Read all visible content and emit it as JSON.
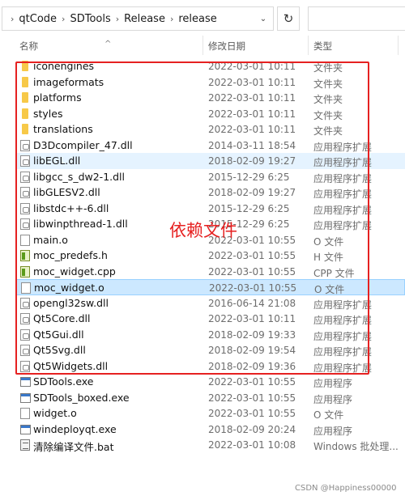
{
  "address": {
    "crumbs": [
      "qtCode",
      "SDTools",
      "Release",
      "release"
    ],
    "separator": "›",
    "dropdown_glyph": "⌄",
    "refresh_glyph": "↻"
  },
  "columns": {
    "name": "名称",
    "date": "修改日期",
    "type": "类型",
    "sort_glyph": "^"
  },
  "files": [
    {
      "name": "iconengines",
      "date": "2022-03-01 10:11",
      "type": "文件夹",
      "icon": "folder-icon"
    },
    {
      "name": "imageformats",
      "date": "2022-03-01 10:11",
      "type": "文件夹",
      "icon": "folder-icon"
    },
    {
      "name": "platforms",
      "date": "2022-03-01 10:11",
      "type": "文件夹",
      "icon": "folder-icon"
    },
    {
      "name": "styles",
      "date": "2022-03-01 10:11",
      "type": "文件夹",
      "icon": "folder-icon"
    },
    {
      "name": "translations",
      "date": "2022-03-01 10:11",
      "type": "文件夹",
      "icon": "folder-icon"
    },
    {
      "name": "D3Dcompiler_47.dll",
      "date": "2014-03-11 18:54",
      "type": "应用程序扩展",
      "icon": "dll-icon"
    },
    {
      "name": "libEGL.dll",
      "date": "2018-02-09 19:27",
      "type": "应用程序扩展",
      "icon": "dll-icon"
    },
    {
      "name": "libgcc_s_dw2-1.dll",
      "date": "2015-12-29 6:25",
      "type": "应用程序扩展",
      "icon": "dll-icon"
    },
    {
      "name": "libGLESV2.dll",
      "date": "2018-02-09 19:27",
      "type": "应用程序扩展",
      "icon": "dll-icon"
    },
    {
      "name": "libstdc++-6.dll",
      "date": "2015-12-29 6:25",
      "type": "应用程序扩展",
      "icon": "dll-icon"
    },
    {
      "name": "libwinpthread-1.dll",
      "date": "2015-12-29 6:25",
      "type": "应用程序扩展",
      "icon": "dll-icon"
    },
    {
      "name": "main.o",
      "date": "2022-03-01 10:55",
      "type": "O 文件",
      "icon": "document-icon"
    },
    {
      "name": "moc_predefs.h",
      "date": "2022-03-01 10:55",
      "type": "H 文件",
      "icon": "header-file-icon"
    },
    {
      "name": "moc_widget.cpp",
      "date": "2022-03-01 10:55",
      "type": "CPP 文件",
      "icon": "cpp-file-icon"
    },
    {
      "name": "moc_widget.o",
      "date": "2022-03-01 10:55",
      "type": "O 文件",
      "icon": "document-icon"
    },
    {
      "name": "opengl32sw.dll",
      "date": "2016-06-14 21:08",
      "type": "应用程序扩展",
      "icon": "dll-icon"
    },
    {
      "name": "Qt5Core.dll",
      "date": "2022-03-01 10:11",
      "type": "应用程序扩展",
      "icon": "dll-icon"
    },
    {
      "name": "Qt5Gui.dll",
      "date": "2018-02-09 19:33",
      "type": "应用程序扩展",
      "icon": "dll-icon"
    },
    {
      "name": "Qt5Svg.dll",
      "date": "2018-02-09 19:54",
      "type": "应用程序扩展",
      "icon": "dll-icon"
    },
    {
      "name": "Qt5Widgets.dll",
      "date": "2018-02-09 19:36",
      "type": "应用程序扩展",
      "icon": "dll-icon"
    },
    {
      "name": "SDTools.exe",
      "date": "2022-03-01 10:55",
      "type": "应用程序",
      "icon": "exe-icon"
    },
    {
      "name": "SDTools_boxed.exe",
      "date": "2022-03-01 10:55",
      "type": "应用程序",
      "icon": "exe-icon"
    },
    {
      "name": "widget.o",
      "date": "2022-03-01 10:55",
      "type": "O 文件",
      "icon": "document-icon"
    },
    {
      "name": "windeployqt.exe",
      "date": "2018-02-09 20:24",
      "type": "应用程序",
      "icon": "exe-icon"
    },
    {
      "name": "清除编译文件.bat",
      "date": "2022-03-01 10:08",
      "type": "Windows 批处理...",
      "icon": "batch-file-icon"
    }
  ],
  "annotation": {
    "label": "依赖文件",
    "color": "#e62121"
  },
  "watermark": "CSDN @Happiness00000",
  "colors": {
    "selected_row": "#cce8ff",
    "hover_row": "#e5f3ff",
    "folder": "#f7c948"
  }
}
